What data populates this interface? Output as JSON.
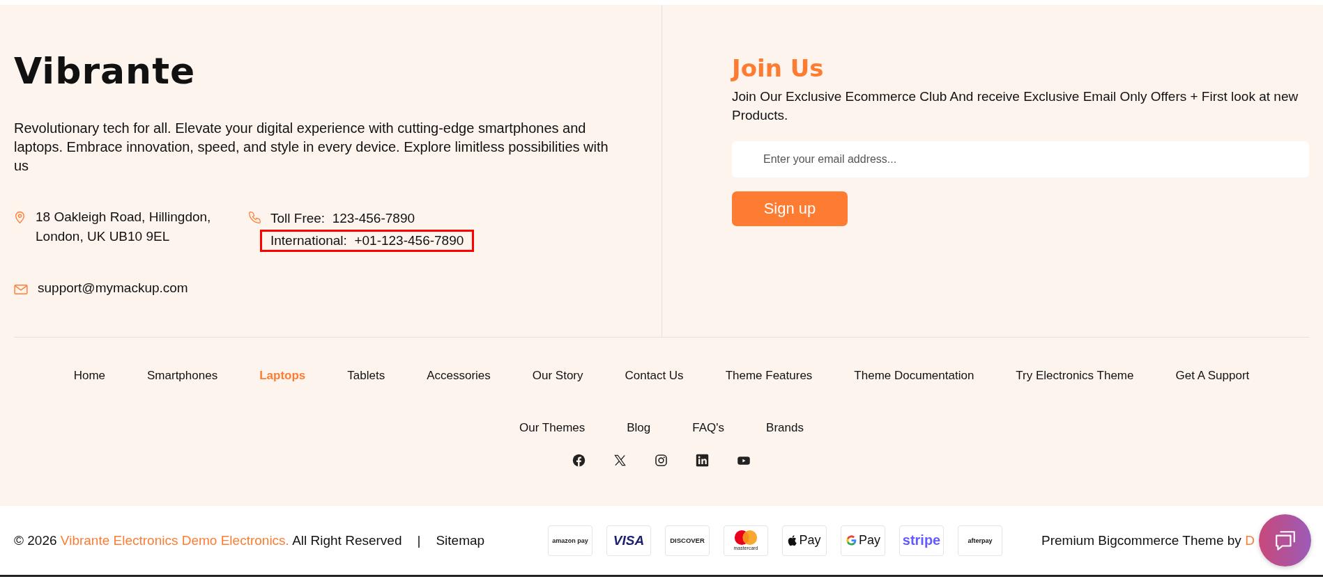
{
  "brand": {
    "logo": "Vibrante",
    "description": "Revolutionary tech for all. Elevate your digital experience with cutting-edge smartphones and laptops. Embrace innovation, speed, and style in every device. Explore limitless possibilities with us"
  },
  "contacts": {
    "address": [
      "18 Oakleigh Road, Hillingdon,",
      "London, UK UB10 9EL"
    ],
    "phones": [
      {
        "label": "Toll Free:",
        "number": "123-456-7890",
        "highlighted": false
      },
      {
        "label": "International:",
        "number": "+01-123-456-7890",
        "highlighted": true
      }
    ],
    "email": "support@mymackup.com"
  },
  "newsletter": {
    "title": "Join Us",
    "text": "Join Our Exclusive Ecommerce Club And receive Exclusive Email Only Offers + First look at new Products.",
    "placeholder": "Enter your email address...",
    "button": "Sign up"
  },
  "nav_rows": [
    [
      {
        "label": "Home",
        "selected": false
      },
      {
        "label": "Smartphones",
        "selected": false
      },
      {
        "label": "Laptops",
        "selected": true
      },
      {
        "label": "Tablets",
        "selected": false
      },
      {
        "label": "Accessories",
        "selected": false
      },
      {
        "label": "Our Story",
        "selected": false
      },
      {
        "label": "Contact Us",
        "selected": false
      },
      {
        "label": "Theme Features",
        "selected": false
      },
      {
        "label": "Theme Documentation",
        "selected": false
      },
      {
        "label": "Try Electronics Theme",
        "selected": false
      },
      {
        "label": "Get A Support",
        "selected": false
      }
    ],
    [
      {
        "label": "Our Themes",
        "selected": false
      },
      {
        "label": "Blog",
        "selected": false
      },
      {
        "label": "FAQ's",
        "selected": false
      },
      {
        "label": "Brands",
        "selected": false
      }
    ]
  ],
  "social": [
    {
      "kind": "facebook"
    },
    {
      "kind": "x"
    },
    {
      "kind": "instagram"
    },
    {
      "kind": "linkedin"
    },
    {
      "kind": "youtube"
    }
  ],
  "bottom": {
    "copyright_prefix": "© 2026",
    "store_link": "Vibrante Electronics Demo Electronics.",
    "rights": "All Right Reserved",
    "separator": "|",
    "sitemap": "Sitemap",
    "payments": [
      {
        "kind": "amazon",
        "label": "amazon pay"
      },
      {
        "kind": "visa",
        "label": "VISA"
      },
      {
        "kind": "discover",
        "label": "DISCOVER"
      },
      {
        "kind": "mastercard",
        "label": "mastercard"
      },
      {
        "kind": "apple",
        "label": "Pay"
      },
      {
        "kind": "google",
        "label": "Pay"
      },
      {
        "kind": "stripe",
        "label": "stripe"
      },
      {
        "kind": "afterpay",
        "label": "afterpay"
      }
    ],
    "credit": "Premium Bigcommerce Theme by",
    "credit_link": "D"
  }
}
